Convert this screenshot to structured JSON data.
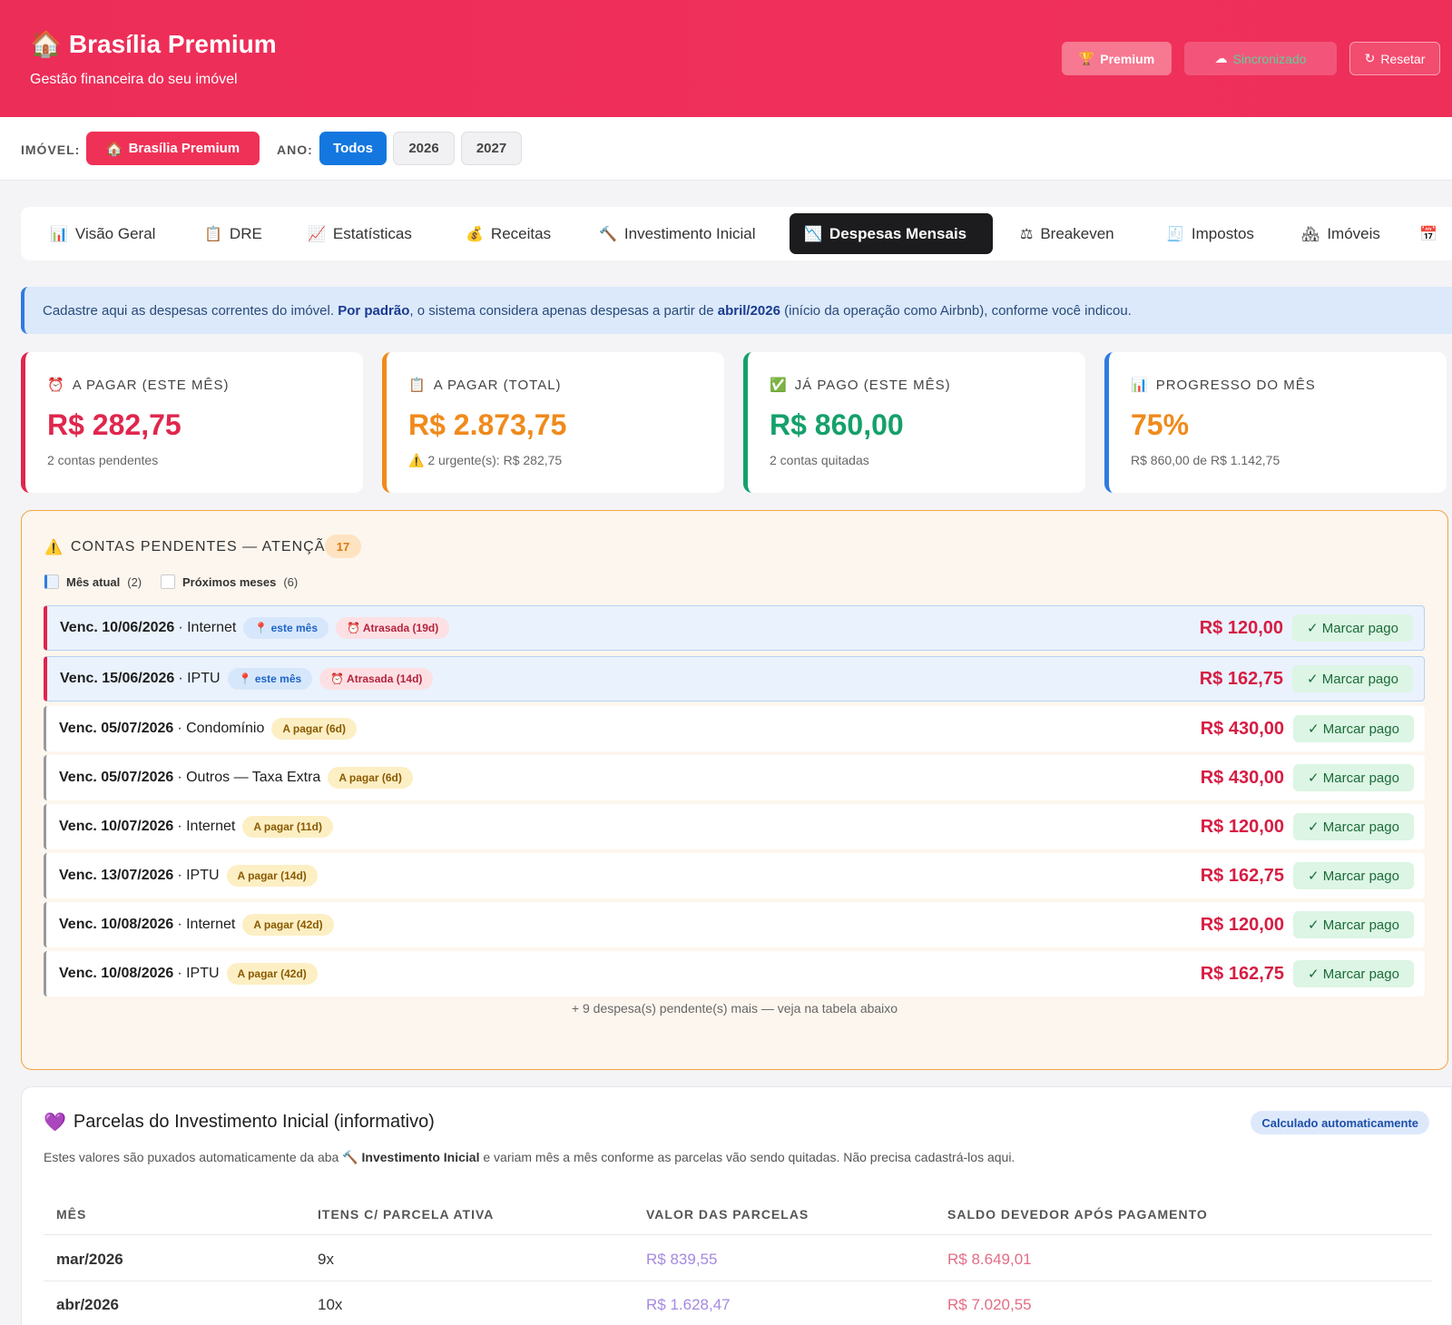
{
  "header": {
    "title_icon": "🏠",
    "title": "Brasília Premium",
    "subtitle": "Gestão financeira do seu imóvel",
    "premium_label": "Premium",
    "premium_icon": "🏆",
    "sync_label": "Sincronizado",
    "sync_icon": "☁",
    "reset_label": "Resetar",
    "reset_icon": "↻"
  },
  "filters": {
    "imovel_label": "IMÓVEL:",
    "imovel_value": "Brasília Premium",
    "imovel_icon": "🏠",
    "ano_label": "ANO:",
    "years": [
      "Todos",
      "2026",
      "2027"
    ],
    "active_year": "Todos"
  },
  "tabs": [
    {
      "icon": "📊",
      "label": "Visão Geral"
    },
    {
      "icon": "📋",
      "label": "DRE"
    },
    {
      "icon": "📈",
      "label": "Estatísticas"
    },
    {
      "icon": "💰",
      "label": "Receitas"
    },
    {
      "icon": "🔨",
      "label": "Investimento Inicial"
    },
    {
      "icon": "📉",
      "label": "Despesas Mensais",
      "active": true
    },
    {
      "icon": "⚖",
      "label": "Breakeven"
    },
    {
      "icon": "🧾",
      "label": "Impostos"
    },
    {
      "icon": "🏘",
      "label": "Imóveis"
    }
  ],
  "banner": {
    "p1": "Cadastre aqui as despesas correntes do imóvel. ",
    "b1": "Por padrão",
    "p2": ", o sistema considera apenas despesas a partir de ",
    "b2": "abril/2026",
    "p3": " (início da operação como Airbnb), conforme você indicou."
  },
  "cards": [
    {
      "icon": "⏰",
      "title": "A PAGAR (ESTE MÊS)",
      "value": "R$ 282,75",
      "sub": "2 contas pendentes",
      "color": "#e0264d"
    },
    {
      "icon": "📋",
      "title": "A PAGAR (TOTAL)",
      "value": "R$ 2.873,75",
      "sub": "⚠️ 2 urgente(s): R$ 282,75",
      "color": "#f08a1c"
    },
    {
      "icon": "✅",
      "title": "JÁ PAGO (ESTE MÊS)",
      "value": "R$ 860,00",
      "sub": "2 contas quitadas",
      "color": "#15a06b"
    },
    {
      "icon": "📊",
      "title": "PROGRESSO DO MÊS",
      "value": "75%",
      "sub": "R$ 860,00 de R$ 1.142,75",
      "color": "#f08a1c",
      "border": "#2f7be0"
    }
  ],
  "pendentes": {
    "icon": "⚠️",
    "title": "CONTAS PENDENTES — ATENÇÃO",
    "count": "17",
    "legend_current": "Mês atual",
    "legend_current_count": "(2)",
    "legend_next": "Próximos meses",
    "legend_next_count": "(6)",
    "mark_label": "✓ Marcar pago",
    "rows": [
      {
        "date": "Venc. 10/06/2026",
        "desc": "· Internet",
        "current": true,
        "tag1": "📍 este mês",
        "tag2": "⏰ Atrasada (19d)",
        "amount": "R$ 120,00"
      },
      {
        "date": "Venc. 15/06/2026",
        "desc": "· IPTU",
        "current": true,
        "tag1": "📍 este mês",
        "tag2": "⏰ Atrasada (14d)",
        "amount": "R$ 162,75"
      },
      {
        "date": "Venc. 05/07/2026",
        "desc": "· Condomínio",
        "current": false,
        "tag1": "A pagar (6d)",
        "amount": "R$ 430,00"
      },
      {
        "date": "Venc. 05/07/2026",
        "desc": "· Outros — Taxa Extra",
        "current": false,
        "tag1": "A pagar (6d)",
        "amount": "R$ 430,00"
      },
      {
        "date": "Venc. 10/07/2026",
        "desc": "· Internet",
        "current": false,
        "tag1": "A pagar (11d)",
        "amount": "R$ 120,00"
      },
      {
        "date": "Venc. 13/07/2026",
        "desc": "· IPTU",
        "current": false,
        "tag1": "A pagar (14d)",
        "amount": "R$ 162,75"
      },
      {
        "date": "Venc. 10/08/2026",
        "desc": "· Internet",
        "current": false,
        "tag1": "A pagar (42d)",
        "amount": "R$ 120,00"
      },
      {
        "date": "Venc. 10/08/2026",
        "desc": "· IPTU",
        "current": false,
        "tag1": "A pagar (42d)",
        "amount": "R$ 162,75"
      }
    ],
    "more": "+ 9 despesa(s) pendente(s) mais — veja na tabela abaixo"
  },
  "parcelas": {
    "icon": "💜",
    "title": "Parcelas do Investimento Inicial (informativo)",
    "badge": "Calculado automaticamente",
    "desc1": "Estes valores são puxados automaticamente da aba 🔨 ",
    "desc_b": "Investimento Inicial",
    "desc2": " e variam mês a mês conforme as parcelas vão sendo quitadas. Não precisa cadastrá-los aqui.",
    "headers": [
      "MÊS",
      "ITENS C/ PARCELA ATIVA",
      "VALOR DAS PARCELAS",
      "SALDO DEVEDOR APÓS PAGAMENTO"
    ],
    "rows": [
      {
        "mes": "mar/2026",
        "itens": "9x",
        "valor": "R$ 839,55",
        "saldo": "R$ 8.649,01"
      },
      {
        "mes": "abr/2026",
        "itens": "10x",
        "valor": "R$ 1.628,47",
        "saldo": "R$ 7.020,55"
      }
    ]
  }
}
